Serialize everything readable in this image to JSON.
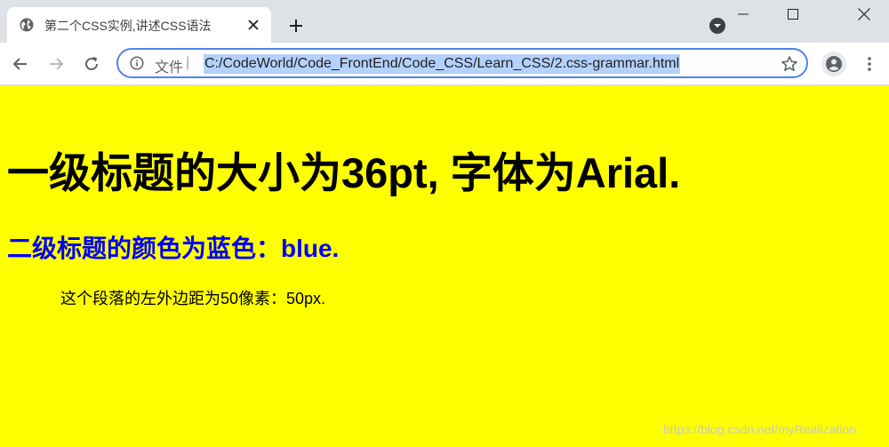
{
  "tab": {
    "title": "第二个CSS实例,讲述CSS语法"
  },
  "omnibox": {
    "scheme_label": "文件",
    "separator": "|",
    "url": "C:/CodeWorld/Code_FrontEnd/Code_CSS/Learn_CSS/2.css-grammar.html"
  },
  "page": {
    "h1": "一级标题的大小为36pt, 字体为Arial.",
    "h2": "二级标题的颜色为蓝色：blue.",
    "paragraph": "这个段落的左外边距为50像素：50px.",
    "watermark": "https://blog.csdn.net/myRealization"
  },
  "colors": {
    "page_background": "#ffff00",
    "h2_color": "#0000ff",
    "omnibox_focus": "#4a86e8",
    "url_selection": "#b4d0fb"
  },
  "icons": {
    "tab_favicon": "globe-icon",
    "tab_close": "close-icon",
    "new_tab": "plus-icon",
    "tab_search": "chevron-down-circle-icon",
    "minimize": "minimize-icon",
    "maximize": "maximize-icon",
    "window_close": "close-icon",
    "back": "arrow-left-icon",
    "forward": "arrow-right-icon",
    "reload": "reload-icon",
    "site_info": "info-icon",
    "bookmark": "star-icon",
    "profile": "person-icon",
    "menu": "kebab-icon"
  }
}
